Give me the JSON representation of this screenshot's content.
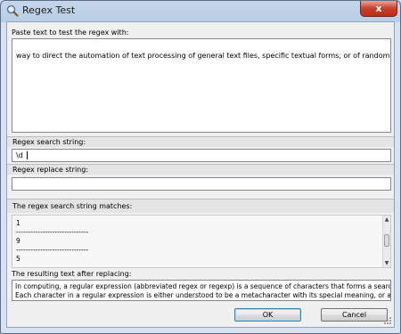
{
  "window": {
    "title": "Regex Test",
    "close_glyph": "x"
  },
  "input_section": {
    "label": "Paste text to test the regex with:",
    "text": "way to direct the automation of text processing of general text files, specific textual forms, or of random input strings."
  },
  "search_section": {
    "label": "Regex search string:",
    "value": "\\d"
  },
  "replace_section": {
    "label": "Regex replace string:",
    "value": ""
  },
  "matches_section": {
    "label": "The regex search string matches:",
    "lines": [
      "1",
      "------------------------------",
      "9",
      "------------------------------",
      "5"
    ]
  },
  "result_section": {
    "label": "The resulting text after replacing:",
    "lines": [
      "In computing, a regular expression (abbreviated regex or regexp) is a sequence of characters that forms a search patte",
      "Each character in a regular expression is either understood to be a metacharacter with its special meaning, or a regular c"
    ]
  },
  "buttons": {
    "ok": "OK",
    "cancel": "Cancel"
  },
  "colors": {
    "title_bar": "#b9cde4",
    "close_button": "#c7402d",
    "dialog_face": "#f0f0f0",
    "default_button_border": "#3c7fb1"
  },
  "icons": {
    "title": "magnifier-icon",
    "close": "close-icon",
    "scroll_up": "scroll-up-arrow-icon",
    "scroll_down": "scroll-down-arrow-icon",
    "resize": "resize-grip-icon"
  }
}
